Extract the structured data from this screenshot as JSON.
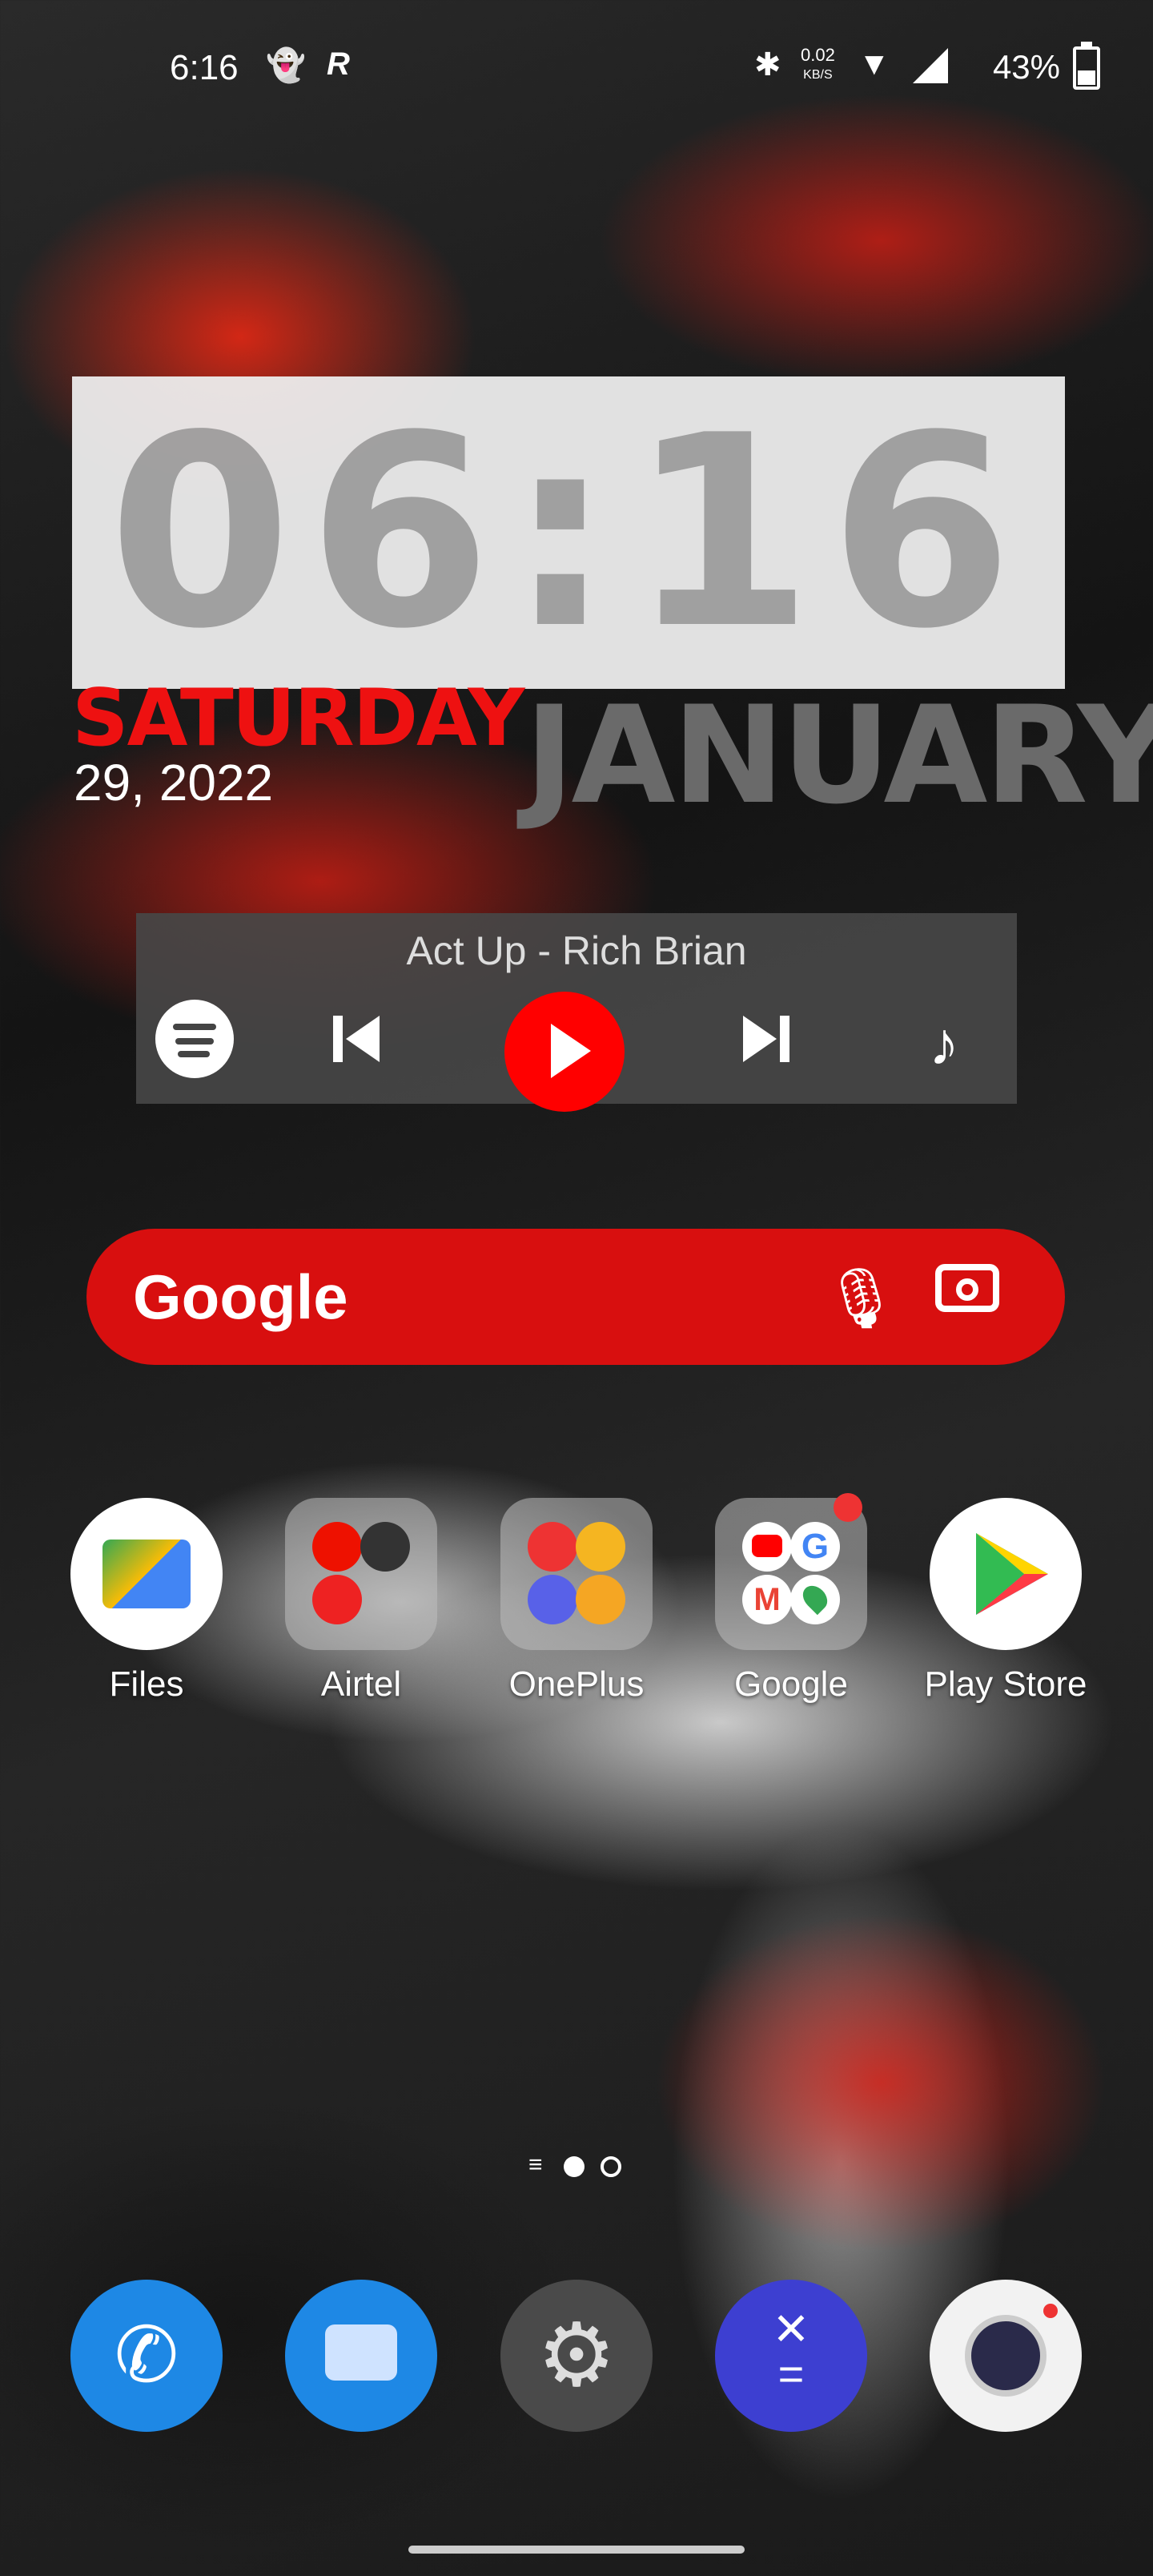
{
  "status_bar": {
    "time": "6:16",
    "net_speed": "0.02",
    "net_unit": "KB/S",
    "battery": "43%",
    "icons": [
      "snapchat-icon",
      "r-app-icon",
      "bluetooth-icon",
      "wifi-icon",
      "signal-icon",
      "battery-icon"
    ]
  },
  "clock_widget": {
    "time": "06:16",
    "day": "SATURDAY",
    "date": "29, 2022",
    "month": "JANUARY"
  },
  "music_widget": {
    "song": "Act Up - Rich Brian",
    "accent": "#ff0000"
  },
  "search_bar": {
    "logo": "Google"
  },
  "apps": [
    {
      "label": "Files"
    },
    {
      "label": "Airtel"
    },
    {
      "label": "OnePlus"
    },
    {
      "label": "Google"
    },
    {
      "label": "Play Store"
    }
  ],
  "page_indicator": {
    "pages": 2,
    "current": 1
  },
  "dock": [
    "phone-icon",
    "messages-icon",
    "settings-icon",
    "calculator-icon",
    "camera-icon"
  ]
}
